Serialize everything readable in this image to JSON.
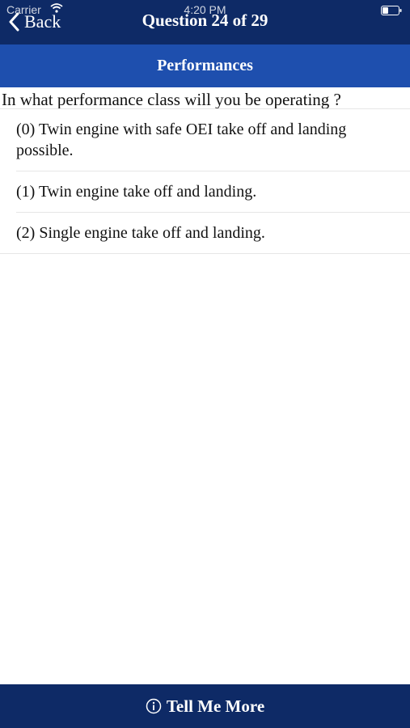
{
  "status_bar": {
    "carrier": "Carrier",
    "time": "4:20 PM"
  },
  "nav": {
    "back_label": "Back",
    "title": "Question 24 of 29"
  },
  "section": {
    "title": "Performances"
  },
  "question": {
    "text": "In what performance class will you be operating ?"
  },
  "answers": [
    {
      "label": "(0) Twin engine with safe OEI take off and landing possible."
    },
    {
      "label": "(1) Twin engine take off and landing."
    },
    {
      "label": "(2) Single engine take off and landing."
    }
  ],
  "bottom": {
    "label": "Tell Me More"
  },
  "colors": {
    "nav_bg": "#0e2a66",
    "section_bg": "#1e4fae",
    "text": "#111111",
    "divider": "#e6e6e6"
  },
  "icons": {
    "back": "chevron-left-icon",
    "wifi": "wifi-icon",
    "battery": "battery-icon",
    "info": "info-circle-icon"
  }
}
